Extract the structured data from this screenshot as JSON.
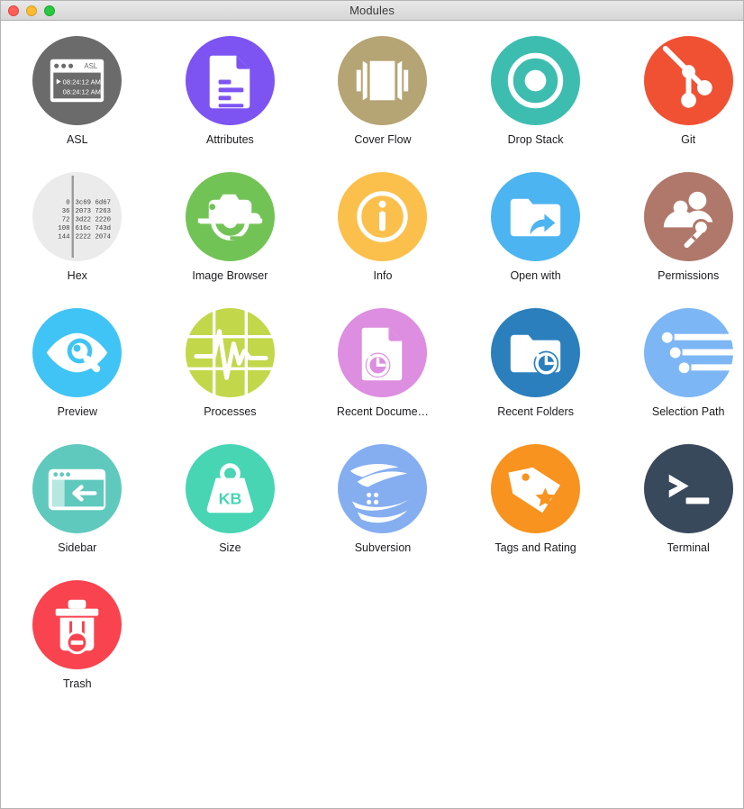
{
  "window": {
    "title": "Modules",
    "controls": [
      {
        "name": "close-button",
        "color": "#ff5f57"
      },
      {
        "name": "minimize-button",
        "color": "#febc2e"
      },
      {
        "name": "maximize-button",
        "color": "#28c840"
      }
    ]
  },
  "modules": [
    {
      "id": "asl",
      "label": "ASL",
      "icon": "asl-icon",
      "color": "#6b6b6b",
      "detail": {
        "window_title": "ASL",
        "row1": "08:24:12 AM",
        "row2": "08:24:12 AM"
      }
    },
    {
      "id": "attributes",
      "label": "Attributes",
      "icon": "document-lines-icon",
      "color": "#7d54f2"
    },
    {
      "id": "cover-flow",
      "label": "Cover Flow",
      "icon": "cover-flow-icon",
      "color": "#b5a474"
    },
    {
      "id": "drop-stack",
      "label": "Drop Stack",
      "icon": "concentric-rings-icon",
      "color": "#3dbdb0"
    },
    {
      "id": "git",
      "label": "Git",
      "icon": "git-branch-icon",
      "color": "#f05133"
    },
    {
      "id": "hex",
      "label": "Hex",
      "icon": "hex-dump-icon",
      "color": "#ebebeb",
      "detail": {
        "offsets": [
          "0",
          "36",
          "72",
          "108",
          "144"
        ],
        "bytes": [
          "3c69 6d67",
          "2073 7263",
          "3d22 2220",
          "616c 743d",
          "2222 2074"
        ]
      }
    },
    {
      "id": "image-browser",
      "label": "Image Browser",
      "icon": "camera-icon",
      "color": "#72c356"
    },
    {
      "id": "info",
      "label": "Info",
      "icon": "info-circle-icon",
      "color": "#fbc04c"
    },
    {
      "id": "open-with",
      "label": "Open with",
      "icon": "folder-arrow-icon",
      "color": "#4cb4f0"
    },
    {
      "id": "permissions",
      "label": "Permissions",
      "icon": "users-key-icon",
      "color": "#b0786a"
    },
    {
      "id": "preview",
      "label": "Preview",
      "icon": "eye-magnifier-icon",
      "color": "#40c4f5"
    },
    {
      "id": "processes",
      "label": "Processes",
      "icon": "pulse-grid-icon",
      "color": "#c3d74a"
    },
    {
      "id": "recent-documents",
      "label": "Recent Docume…",
      "icon": "document-clock-icon",
      "color": "#dd8ee0"
    },
    {
      "id": "recent-folders",
      "label": "Recent Folders",
      "icon": "folder-clock-icon",
      "color": "#2b7fbd"
    },
    {
      "id": "selection-path",
      "label": "Selection Path",
      "icon": "selection-path-icon",
      "color": "#7cb6f5"
    },
    {
      "id": "sidebar",
      "label": "Sidebar",
      "icon": "sidebar-arrow-icon",
      "color": "#5fc9bd"
    },
    {
      "id": "size",
      "label": "Size",
      "icon": "weight-kb-icon",
      "color": "#47d5b4",
      "detail": {
        "unit": "KB"
      }
    },
    {
      "id": "subversion",
      "label": "Subversion",
      "icon": "subversion-globe-icon",
      "color": "#85aef0"
    },
    {
      "id": "tags-and-rating",
      "label": "Tags and Rating",
      "icon": "tag-star-icon",
      "color": "#f7931e"
    },
    {
      "id": "terminal",
      "label": "Terminal",
      "icon": "terminal-prompt-icon",
      "color": "#39495c"
    },
    {
      "id": "trash",
      "label": "Trash",
      "icon": "trash-minus-icon",
      "color": "#f9434f"
    }
  ]
}
